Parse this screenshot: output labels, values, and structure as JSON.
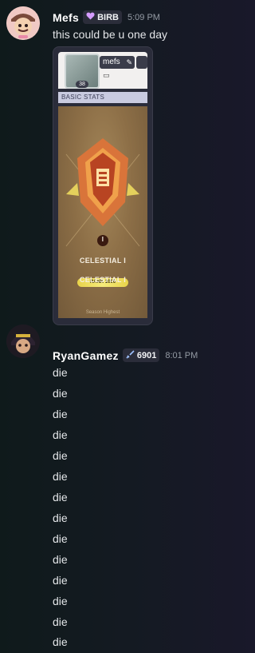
{
  "messages": [
    {
      "username": "Mefs",
      "tag": {
        "icon": "heart-icon",
        "label": "BIRB",
        "icon_color": "#d59cff"
      },
      "time": "5:09 PM",
      "text": "this could be u one day",
      "embed": {
        "profile_name": "mefs",
        "level": "38",
        "section_title": "BASIC STATS",
        "rank_title": "CELESTIAL I",
        "rank_label": "RANK 1000",
        "season_highest_label": "Season Highest",
        "season_highest_rank": "CELESTIAL I",
        "tier_roman": "I"
      }
    },
    {
      "username": "RyanGamez",
      "tag": {
        "icon": "sword-icon",
        "label": "6901"
      },
      "time": "8:01 PM",
      "lines": [
        "die",
        "die",
        "die",
        "die",
        "die",
        "die",
        "die",
        "die",
        "die",
        "die",
        "die",
        "die",
        "die",
        "die"
      ]
    }
  ]
}
